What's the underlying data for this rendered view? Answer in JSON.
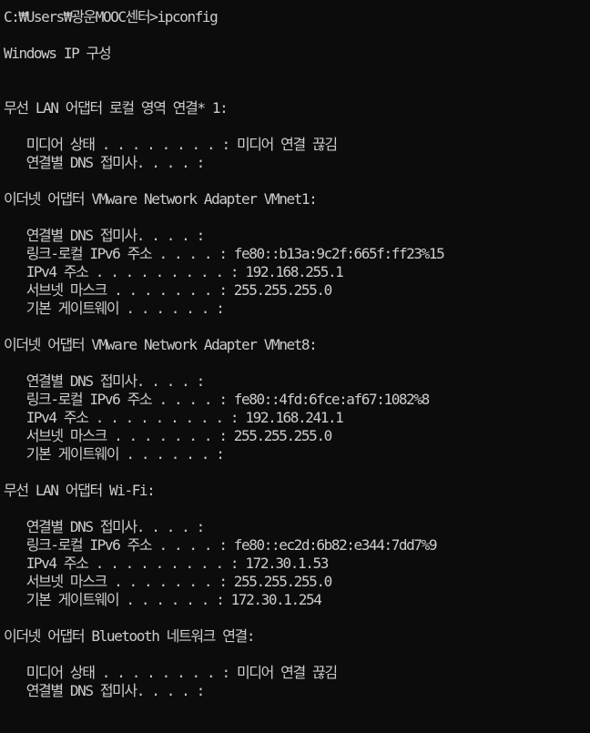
{
  "console": {
    "text_color": "#cccccc",
    "background_color": "#0c0c0c",
    "lines": [
      "C:₩Users₩광운MOOC센터>ipconfig",
      "",
      "Windows IP 구성",
      "",
      "",
      "무선 LAN 어댑터 로컬 영역 연결* 1:",
      "",
      "   미디어 상태 . . . . . . . . : 미디어 연결 끊김",
      "   연결별 DNS 접미사. . . . :",
      "",
      "이더넷 어댑터 VMware Network Adapter VMnet1:",
      "",
      "   연결별 DNS 접미사. . . . :",
      "   링크-로컬 IPv6 주소 . . . . : fe80::b13a:9c2f:665f:ff23%15",
      "   IPv4 주소 . . . . . . . . . : 192.168.255.1",
      "   서브넷 마스크 . . . . . . . : 255.255.255.0",
      "   기본 게이트웨이 . . . . . . :",
      "",
      "이더넷 어댑터 VMware Network Adapter VMnet8:",
      "",
      "   연결별 DNS 접미사. . . . :",
      "   링크-로컬 IPv6 주소 . . . . : fe80::4fd:6fce:af67:1082%8",
      "   IPv4 주소 . . . . . . . . . : 192.168.241.1",
      "   서브넷 마스크 . . . . . . . : 255.255.255.0",
      "   기본 게이트웨이 . . . . . . :",
      "",
      "무선 LAN 어댑터 Wi-Fi:",
      "",
      "   연결별 DNS 접미사. . . . :",
      "   링크-로컬 IPv6 주소 . . . . : fe80::ec2d:6b82:e344:7dd7%9",
      "   IPv4 주소 . . . . . . . . . : 172.30.1.53",
      "   서브넷 마스크 . . . . . . . : 255.255.255.0",
      "   기본 게이트웨이 . . . . . . : 172.30.1.254",
      "",
      "이더넷 어댑터 Bluetooth 네트워크 연결:",
      "",
      "   미디어 상태 . . . . . . . . : 미디어 연결 끊김",
      "   연결별 DNS 접미사. . . . :"
    ]
  }
}
